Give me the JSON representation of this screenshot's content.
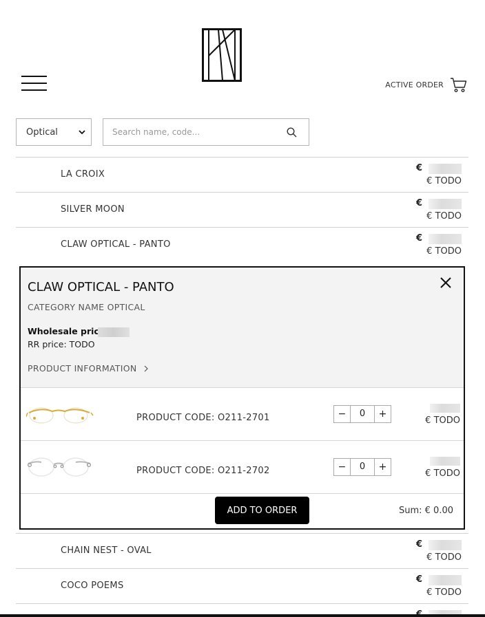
{
  "header": {
    "logo": "logo-icon",
    "menu_icon": "hamburger-menu-icon",
    "active_order_label": "ACTIVE ORDER",
    "cart_icon": "cart-icon"
  },
  "filters": {
    "category_selected": "Optical",
    "search_placeholder": "Search name, code...",
    "search_icon": "search-icon"
  },
  "products_above": [
    {
      "name": "LA CROIX",
      "currency": "€",
      "rr_price": "€ TODO"
    },
    {
      "name": "SILVER MOON",
      "currency": "€",
      "rr_price": "€ TODO"
    },
    {
      "name": "CLAW OPTICAL -  PANTO",
      "currency": "€",
      "rr_price": "€ TODO"
    }
  ],
  "detail": {
    "title": "CLAW OPTICAL -  PANTO",
    "category": "CATEGORY NAME OPTICAL",
    "wholesale_label": "Wholesale price:",
    "rr_label": "RR price: TODO",
    "product_info_label": "PRODUCT INFORMATION",
    "variants": [
      {
        "code_label": "PRODUCT CODE:  O211-2701",
        "qty": "0",
        "rr_price": "€ TODO",
        "frame_color": "#d4ad3c"
      },
      {
        "code_label": "PRODUCT CODE:  O211-2702",
        "qty": "0",
        "rr_price": "€ TODO",
        "frame_color": "#b8b8b8"
      }
    ],
    "add_button": "ADD TO ORDER",
    "sum_label": "Sum: €  0.00"
  },
  "products_below": [
    {
      "name": "CHAIN NEST - OVAL",
      "currency": "€",
      "rr_price": "€ TODO"
    },
    {
      "name": "COCO POEMS",
      "currency": "€",
      "rr_price": "€ TODO"
    },
    {
      "name": "",
      "currency": "€",
      "rr_price": ""
    }
  ]
}
